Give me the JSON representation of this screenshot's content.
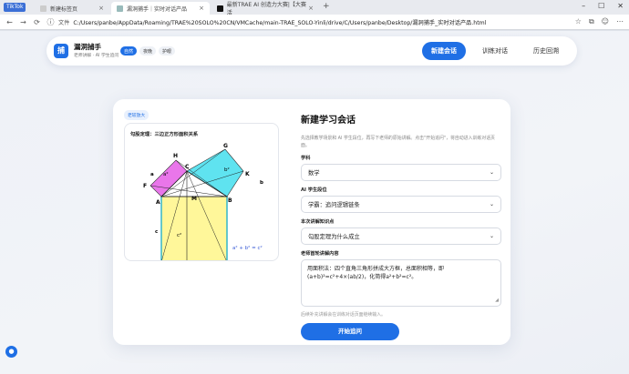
{
  "browser": {
    "badge": "TikTok",
    "tabs": [
      {
        "title": "新建标签页",
        "active": false
      },
      {
        "title": "漏洞捕手｜实时对话产品",
        "active": true
      },
      {
        "title": "最新TRAE AI 创造力大赛|【大赛活",
        "active": false
      }
    ],
    "address_label": "文件",
    "url": "C:/Users/panbe/AppData/Roaming/TRAE%20SOLO%20CN/VMCache/main-TRAE_SOLO-Yinli/drive/C/Users/panbe/Desktop/漏洞捕手_实时对话产品.html"
  },
  "header": {
    "logo": "捕",
    "brand": "漏洞捕手",
    "subtitle": "老师讲解 · AI 学生追问",
    "modes": [
      "自然",
      "夜晚",
      "护眼"
    ],
    "nav": [
      "新建会话",
      "训练对话",
      "历史回溯"
    ]
  },
  "figure": {
    "chip": "老较放大",
    "title": "勾股定理：三边正方形面积关系",
    "labels": {
      "H": "H",
      "C": "C",
      "G": "G",
      "F": "F",
      "A": "A",
      "M": "M",
      "B": "B",
      "K": "K",
      "a2": "a²",
      "b2": "b²",
      "c2": "c²",
      "a": "a",
      "b": "b",
      "c": "c",
      "formula": "a² + b² = c²"
    }
  },
  "form": {
    "title": "新建学习会话",
    "desc": "先选择教学场景和 AI 学生段位，再写下老师的原始讲解。点击\"开始追问\"，将自动进入训练对话页面。",
    "subject_label": "学科",
    "subject_value": "数学",
    "level_label": "AI 学生段位",
    "level_value": "学霸：追问逻辑链条",
    "topic_label": "本次讲解知识点",
    "topic_value": "勾股定理为什么成立",
    "content_label": "老师首轮讲解内容",
    "content_value": "用面积法：四个直角三角形拼成大方框，总面积相等，即(a+b)²=c²+4×(ab/2)，化简得a²+b²=c²。",
    "hint": "后续补充讲解会在训练对话页面继续输入。",
    "start_label": "开始追问"
  }
}
